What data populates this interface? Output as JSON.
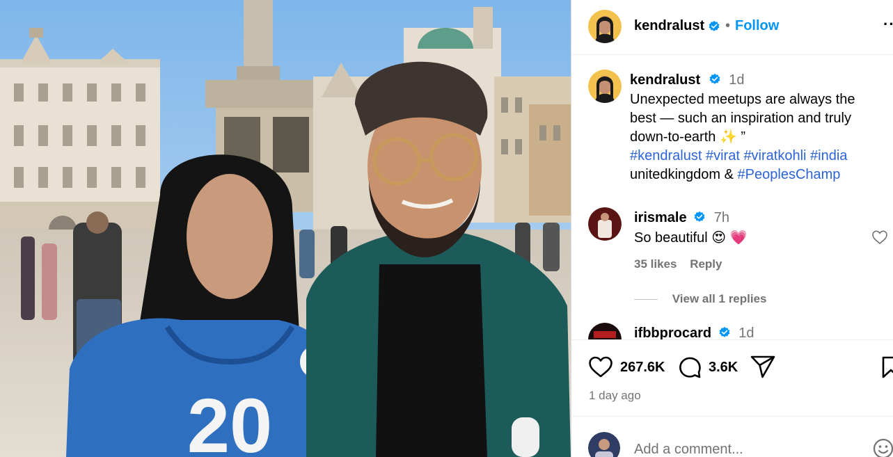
{
  "photo": {
    "jersey_number": "20"
  },
  "header": {
    "username": "kendralust",
    "separator": "•",
    "follow_label": "Follow",
    "more_label": "···"
  },
  "caption": {
    "username": "kendralust",
    "time": "1d",
    "text": "Unexpected meetups are always the best — such an inspiration and truly down-to-earth ✨ ”",
    "tags": [
      "#kendralust",
      "#virat",
      "#viratkohli",
      "#india"
    ],
    "plain_text": "unitedkingdom &",
    "last_tag": "#PeoplesChamp"
  },
  "comments": [
    {
      "username": "irismale",
      "time": "7h",
      "text": "So beautiful 😍 💗",
      "likes": "35 likes",
      "reply_label": "Reply",
      "view_replies": "View all 1 replies"
    },
    {
      "username": "ifbbprocard",
      "time": "1d"
    }
  ],
  "actions": {
    "like_count": "267.6K",
    "comment_count": "3.6K",
    "posted_ago": "1 day ago"
  },
  "add_comment": {
    "placeholder": "Add a comment..."
  },
  "colors": {
    "link_blue": "#0095f6",
    "hashtag_blue": "#2b63d9",
    "secondary_text": "#737373",
    "verified_blue": "#0095f6",
    "heart_red": "#ff3040"
  }
}
